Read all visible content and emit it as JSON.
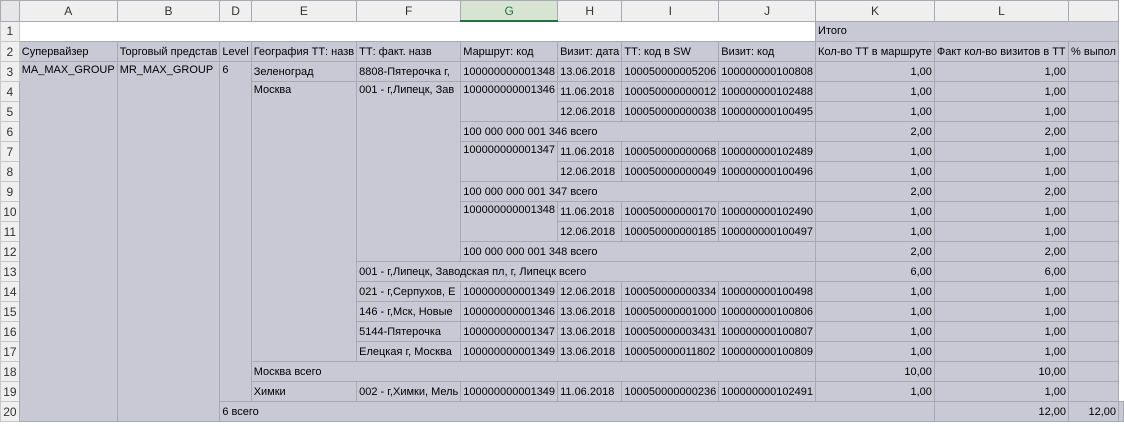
{
  "columns": [
    "A",
    "B",
    "D",
    "E",
    "F",
    "G",
    "H",
    "I",
    "J",
    "K",
    "L",
    ""
  ],
  "active_column": "G",
  "row_numbers": [
    "1",
    "2",
    "3",
    "4",
    "5",
    "6",
    "7",
    "8",
    "9",
    "10",
    "11",
    "12",
    "13",
    "14",
    "15",
    "16",
    "17",
    "18",
    "19",
    "20"
  ],
  "r1": {
    "total": "Итого"
  },
  "r2": {
    "a": "Супервайзер",
    "b": "Торговый представ",
    "d": "Level",
    "e": "География ТТ: назв",
    "f": "ТТ: факт. назв",
    "g": "Маршрут: код",
    "h": "Визит: дата",
    "i": "ТТ: код в SW",
    "j": "Визит: код",
    "k": "Кол-во ТТ в маршруте",
    "l": "Факт кол-во визитов в ТТ",
    "m": "% выпол"
  },
  "r3": {
    "a": "MA_MAX_GROUP",
    "b": "MR_MAX_GROUP",
    "d": "6",
    "e": "Зеленоград",
    "f": "8808-Пятерочка г,",
    "g": "100000000001348",
    "h": "13.06.2018",
    "i": "100050000005206",
    "j": "100000000100808",
    "k": "1,00",
    "l": "1,00"
  },
  "r4": {
    "e": "Москва",
    "f": "001 - г,Липецк, Зав",
    "g": "100000000001346",
    "h": "11.06.2018",
    "i": "100050000000012",
    "j": "100000000102488",
    "k": "1,00",
    "l": "1,00"
  },
  "r5": {
    "h": "12.06.2018",
    "i": "100050000000038",
    "j": "100000000100495",
    "k": "1,00",
    "l": "1,00"
  },
  "r6": {
    "g": "100 000 000 001 346 всего",
    "k": "2,00",
    "l": "2,00"
  },
  "r7": {
    "g": "100000000001347",
    "h": "11.06.2018",
    "i": "100050000000068",
    "j": "100000000102489",
    "k": "1,00",
    "l": "1,00"
  },
  "r8": {
    "h": "12.06.2018",
    "i": "100050000000049",
    "j": "100000000100496",
    "k": "1,00",
    "l": "1,00"
  },
  "r9": {
    "g": "100 000 000 001 347 всего",
    "k": "2,00",
    "l": "2,00"
  },
  "r10": {
    "g": "100000000001348",
    "h": "11.06.2018",
    "i": "100050000000170",
    "j": "100000000102490",
    "k": "1,00",
    "l": "1,00"
  },
  "r11": {
    "h": "12.06.2018",
    "i": "100050000000185",
    "j": "100000000100497",
    "k": "1,00",
    "l": "1,00"
  },
  "r12": {
    "g": "100 000 000 001 348 всего",
    "k": "2,00",
    "l": "2,00"
  },
  "r13": {
    "f": "001 - г,Липецк, Заводская пл, г, Липецк всего",
    "k": "6,00",
    "l": "6,00"
  },
  "r14": {
    "f": "021 - г,Серпухов, Е",
    "g": "100000000001349",
    "h": "12.06.2018",
    "i": "100050000000334",
    "j": "100000000100498",
    "k": "1,00",
    "l": "1,00"
  },
  "r15": {
    "f": "146 - г,Мск, Новые",
    "g": "100000000001346",
    "h": "13.06.2018",
    "i": "100050000001000",
    "j": "100000000100806",
    "k": "1,00",
    "l": "1,00"
  },
  "r16": {
    "f": "5144-Пятерочка",
    "g": "100000000001347",
    "h": "13.06.2018",
    "i": "100050000003431",
    "j": "100000000100807",
    "k": "1,00",
    "l": "1,00"
  },
  "r17": {
    "f": "Елецкая г, Москва",
    "g": "100000000001349",
    "h": "13.06.2018",
    "i": "100050000011802",
    "j": "100000000100809",
    "k": "1,00",
    "l": "1,00"
  },
  "r18": {
    "e": "Москва всего",
    "k": "10,00",
    "l": "10,00"
  },
  "r19": {
    "e": "Химки",
    "f": "002 - г,Химки, Мель",
    "g": "100000000001349",
    "h": "11.06.2018",
    "i": "100050000000236",
    "j": "100000000102491",
    "k": "1,00",
    "l": "1,00"
  },
  "r20": {
    "d": "6 всего",
    "k": "12,00",
    "l": "12,00"
  }
}
